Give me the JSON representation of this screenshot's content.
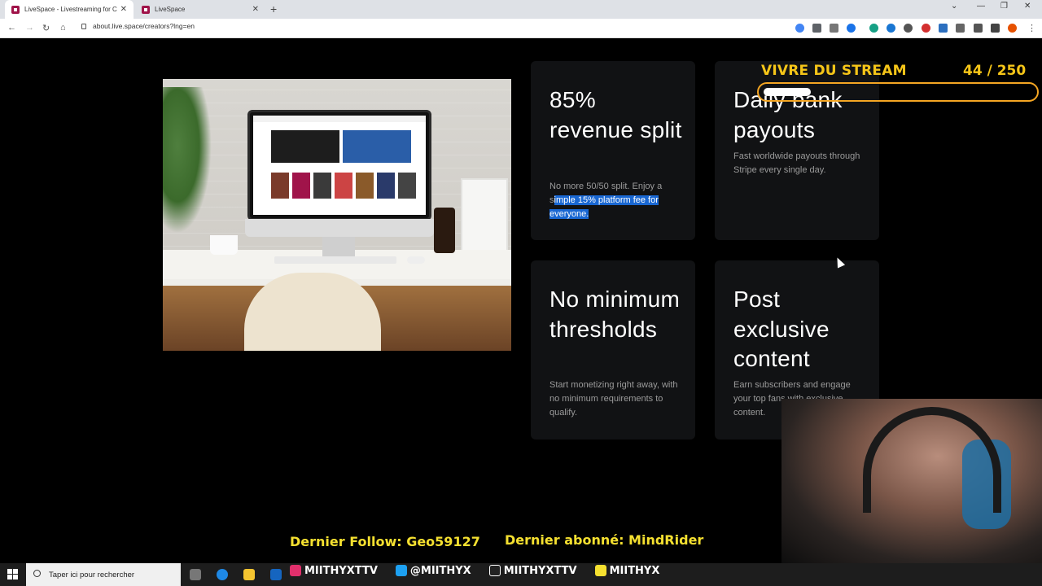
{
  "browser": {
    "tabs": [
      {
        "title": "LiveSpace - Livestreaming for Cr",
        "active": true
      },
      {
        "title": "LiveSpace",
        "active": false
      }
    ],
    "new_tab": "+",
    "url": "about.live.space/creators?lng=en",
    "nav": {
      "back": "←",
      "forward": "→",
      "reload": "↻",
      "home": "⌂"
    },
    "window_controls": {
      "dropdown": "⌄",
      "minimize": "—",
      "restore": "❐",
      "close": "✕"
    }
  },
  "features": [
    {
      "title": "85% revenue split",
      "desc_plain": "No more 50/50 split. Enjoy a s",
      "desc_highlight": "imple 15% platform fee for everyone."
    },
    {
      "title": "Daily bank payouts",
      "desc": "Fast worldwide payouts through Stripe every single day."
    },
    {
      "title": "No minimum thresholds",
      "desc": "Start monetizing right away, with no minimum requirements to qualify."
    },
    {
      "title": "Post exclusive content",
      "desc": "Earn subscribers and engage your top fans with exclusive content."
    }
  ],
  "overlay": {
    "goal_label": "VIVRE DU STREAM",
    "goal_count": "44  / 250",
    "goal_progress": 0.176,
    "last_follow": "Dernier Follow: Geo59127",
    "last_sub": "Dernier abonné: MindRider",
    "socials": [
      {
        "icon": "instagram-icon",
        "handle": "MIITHYXTTV",
        "color": "#e1306c"
      },
      {
        "icon": "twitter-icon",
        "handle": "@MIITHYX",
        "color": "#f5e030"
      },
      {
        "icon": "tiktok-icon",
        "handle": "MIITHYXTTV",
        "color": "#ffffff"
      },
      {
        "icon": "youtube-icon",
        "handle": "MIITHYX",
        "color": "#f5e030"
      }
    ]
  },
  "taskbar": {
    "search_placeholder": "Taper ici pour rechercher"
  },
  "colors": {
    "accent": "#a0144a",
    "highlight": "#1967d2",
    "overlay_gold": "#f5c518"
  }
}
